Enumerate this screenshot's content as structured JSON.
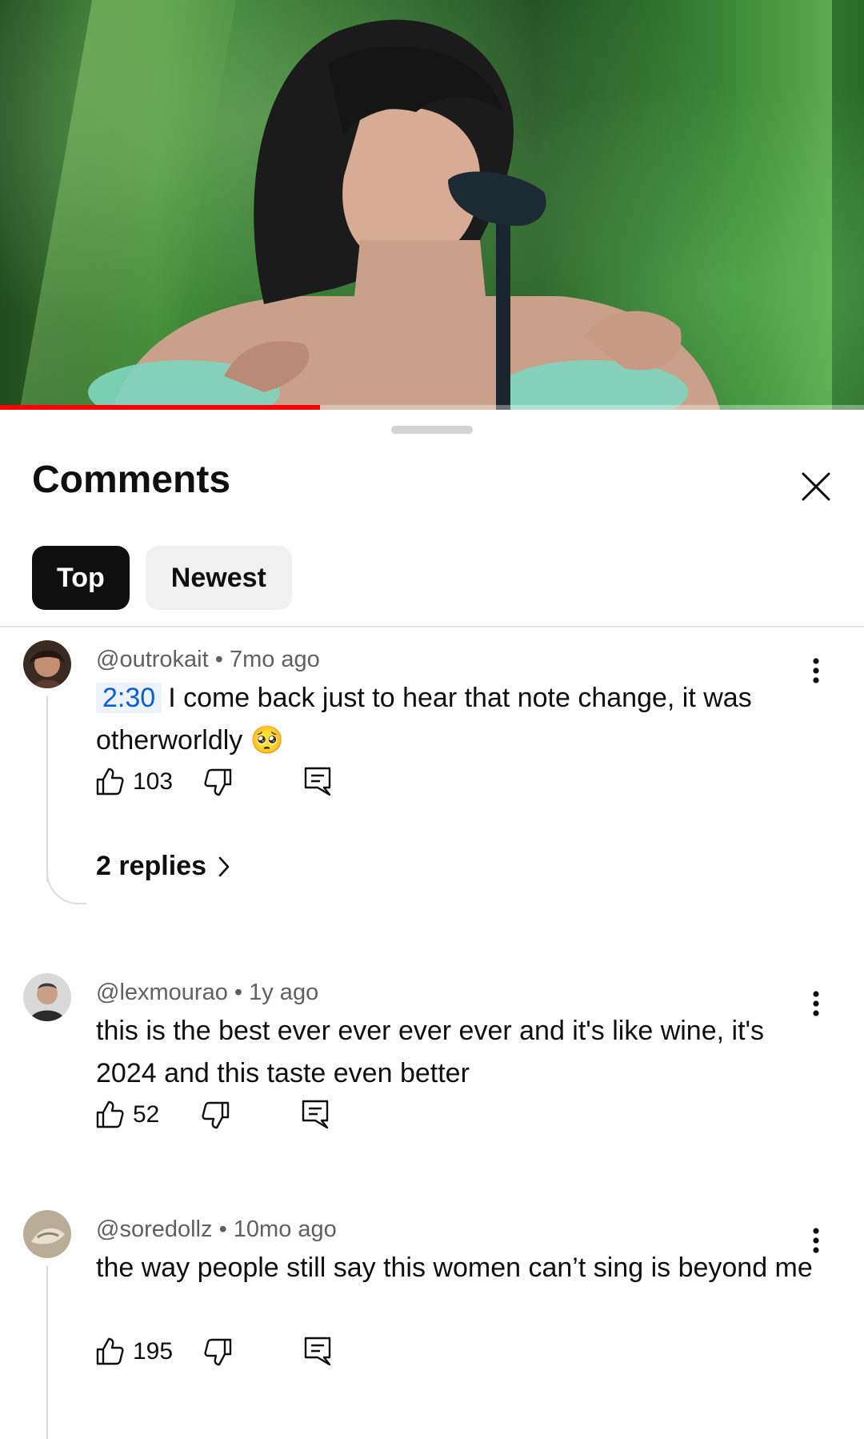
{
  "video": {
    "progress_fraction": 0.37,
    "accent_color": "#ff0000"
  },
  "sheet": {
    "title": "Comments",
    "close_icon": "close-icon",
    "tabs": [
      {
        "label": "Top",
        "selected": true
      },
      {
        "label": "Newest",
        "selected": false
      }
    ]
  },
  "comments": [
    {
      "author": "@outrokait",
      "age": "7mo ago",
      "timestamp": "2:30",
      "text": "I come back just to hear that note change, it was otherworldly",
      "emoji": "🥺",
      "likes": "103",
      "replies_label": "2 replies"
    },
    {
      "author": "@lexmourao",
      "age": "1y ago",
      "text": "this is the best ever ever ever ever and it's like wine, it's 2024 and this taste even better",
      "likes": "52"
    },
    {
      "author": "@soredollz",
      "age": "10mo ago",
      "text": "the way people still say this women can’t sing is beyond me",
      "likes": "195"
    }
  ],
  "meta_separator": "•"
}
